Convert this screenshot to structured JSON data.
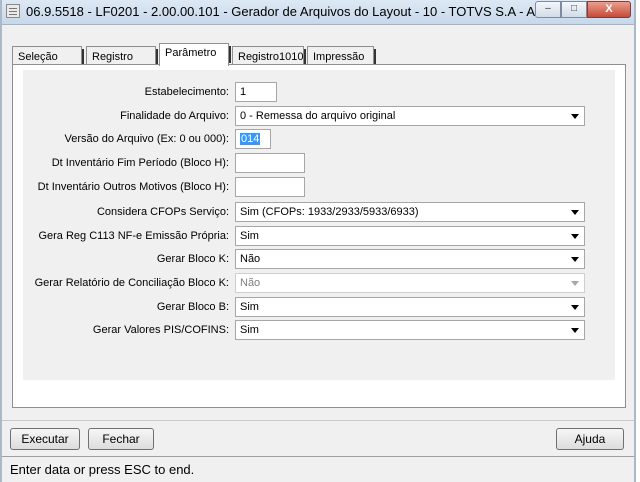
{
  "window": {
    "title": "06.9.5518 - LF0201 - 2.00.00.101 - Gerador de Arquivos do Layout - 10 - TOTVS S.A - Ambient...",
    "minimize": "–",
    "maximize": "□",
    "close": "X"
  },
  "tabs": [
    {
      "label": "Seleção"
    },
    {
      "label": "Registro"
    },
    {
      "label": "Parâmetro"
    },
    {
      "label": "Registro1010"
    },
    {
      "label": "Impressão"
    }
  ],
  "active_tab": "Parâmetro",
  "form": {
    "estabelecimento": {
      "label": "Estabelecimento:",
      "value": "1"
    },
    "finalidade": {
      "label": "Finalidade do Arquivo:",
      "value": "0 - Remessa do arquivo original"
    },
    "versao": {
      "label": "Versão do Arquivo (Ex: 0 ou 000):",
      "value": "014"
    },
    "dt_fim_periodo": {
      "label": "Dt Inventário Fim Período (Bloco H):",
      "value": ""
    },
    "dt_outros": {
      "label": "Dt Inventário Outros Motivos (Bloco H):",
      "value": ""
    },
    "cfops": {
      "label": "Considera CFOPs Serviço:",
      "value": "Sim (CFOPs: 1933/2933/5933/6933)"
    },
    "c113": {
      "label": "Gera Reg C113 NF-e Emissão Própria:",
      "value": "Sim"
    },
    "bloco_k": {
      "label": "Gerar Bloco K:",
      "value": "Não"
    },
    "conciliacao_k": {
      "label": "Gerar Relatório de Conciliação Bloco K:",
      "value": "Não"
    },
    "bloco_b": {
      "label": "Gerar Bloco B:",
      "value": "Sim"
    },
    "pis_cofins": {
      "label": "Gerar Valores PIS/COFINS:",
      "value": "Sim"
    }
  },
  "buttons": {
    "executar": "Executar",
    "fechar": "Fechar",
    "ajuda": "Ajuda"
  },
  "status": "Enter data or press ESC to end."
}
